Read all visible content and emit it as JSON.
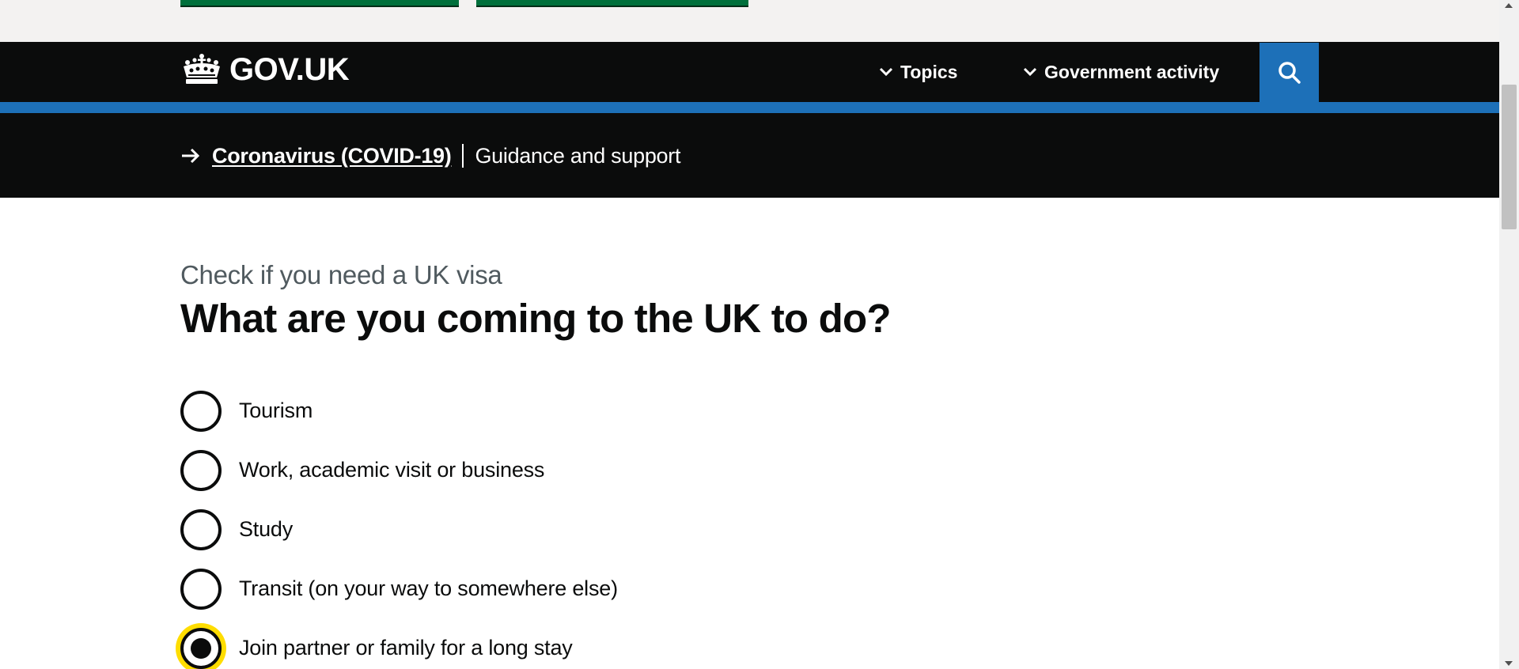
{
  "header": {
    "logo_text": "GOV.UK",
    "nav": [
      {
        "label": "Topics"
      },
      {
        "label": "Government activity"
      }
    ],
    "search_icon": "search-icon"
  },
  "covid_banner": {
    "link_text": "Coronavirus (COVID-19)",
    "text": "Guidance and support",
    "icon": "arrow-right-icon"
  },
  "main": {
    "caption": "Check if you need a UK visa",
    "title": "What are you coming to the UK to do?",
    "options": [
      {
        "label": "Tourism",
        "checked": false
      },
      {
        "label": "Work, academic visit or business",
        "checked": false
      },
      {
        "label": "Study",
        "checked": false
      },
      {
        "label": "Transit (on your way to somewhere else)",
        "checked": false
      },
      {
        "label": "Join partner or family for a long stay",
        "checked": true,
        "focused": true
      }
    ]
  },
  "colors": {
    "header_bg": "#0b0c0c",
    "brand_blue": "#1d70b8",
    "focus_yellow": "#ffdd00",
    "button_green": "#00703c",
    "caption_grey": "#505a5f"
  }
}
